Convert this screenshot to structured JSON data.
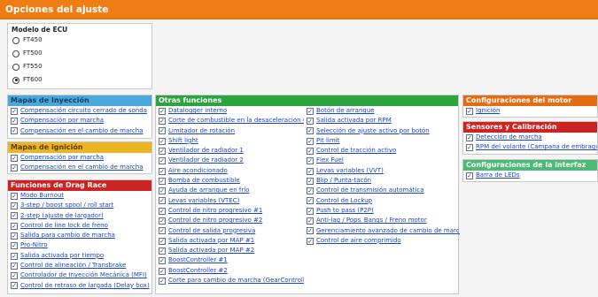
{
  "title": "Opciones del ajuste",
  "ecu": {
    "heading": "Modelo de ECU",
    "options": [
      "FT450",
      "FT500",
      "FT550",
      "FT600"
    ],
    "selected": "FT600"
  },
  "mapas_inyeccion": {
    "heading": "Mapas de Inyección",
    "items": [
      "Compensación circuito cerrado de sonda",
      "Compensación por marcha",
      "Compensación en el cambio de marcha"
    ]
  },
  "mapas_ignicion": {
    "heading": "Mapas de ignición",
    "items": [
      "Compensación por marcha",
      "Compensación en el cambio de marcha"
    ]
  },
  "drag_race": {
    "heading": "Funciones de Drag Race",
    "items": [
      "Modo Burnout",
      "3-step / boost spool / roll start",
      "2-step (ajuste de largador)",
      "Control de line lock de freno",
      "Salida para cambio de marcha",
      "Pro-Nitro",
      "Salida activada por tiempo",
      "Control de alineación / Transbrake",
      "Controlador de Inyección Mecánica (MFI)",
      "Control de retraso de largada (Delay box)"
    ]
  },
  "otras": {
    "heading": "Otras funciones",
    "col1": [
      "Datalogger interno",
      "Corte de combustible en la desaceleracion (cutoff)",
      "Limitador de rotación",
      "Shift light",
      "Ventilador de radiador 1",
      "Ventilador de radiador 2",
      "Aire acondicionado",
      "Bomba de combustible",
      "Ayuda de arranque en frío",
      "Levas variables (VTEC)",
      "Control de nitro progresivo #1",
      "Control de nitro progresivo #2",
      "Control de salida progresiva",
      "Salida activada por MAP #1",
      "Salida activada por MAP #2",
      "BoostController #1",
      "BoostController #2",
      "Corte para cambio de marcha (GearController)"
    ],
    "col2": [
      "Botón de arranque",
      "Salida activada por RPM",
      "Selección de ajuste activo por botón",
      "Pit limit",
      "Control de tracción activo",
      "Flex Fuel",
      "Levas variables (VVT)",
      "Blip / Punta-tacón",
      "Control de transmisión automática",
      "Control de Lockup",
      "Push to pass (P2P)",
      "Anti-lag / Pops_Bangs / Freno motor",
      "Gerenciamiento avanzado de cambio de marchas",
      "Control de aire comprimido"
    ]
  },
  "motor": {
    "heading": "Configuraciones del motor",
    "items": [
      "Ignición"
    ]
  },
  "sensores": {
    "heading": "Sensores y Calibración",
    "items": [
      "Detección de marcha",
      "RPM del volante (Campana de embrague)"
    ]
  },
  "interfaz": {
    "heading": "Configuraciones de la interfaz",
    "items": [
      "Barra de LEDs"
    ]
  }
}
